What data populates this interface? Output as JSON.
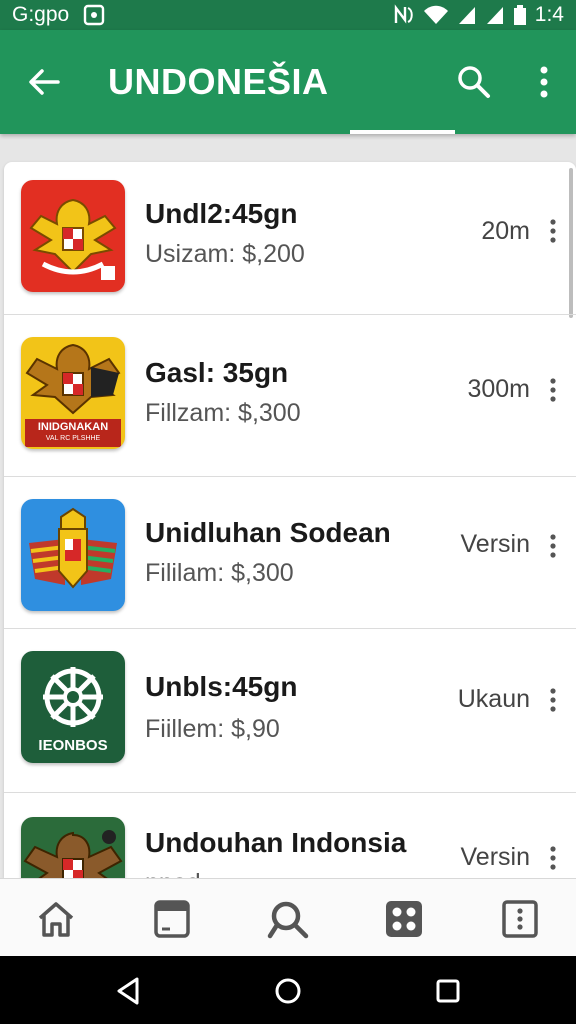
{
  "status_bar": {
    "carrier": "G:gpo",
    "time": "1:4",
    "icons": [
      "notification-icon",
      "nfc-icon",
      "wifi-icon",
      "signal-icon",
      "signal-icon",
      "battery-icon"
    ]
  },
  "app_bar": {
    "title": "UNDONEŠIA",
    "back_icon": "arrow-back-icon",
    "search_icon": "search-icon",
    "more_icon": "more-vert-icon"
  },
  "list": {
    "items": [
      {
        "title": "Undl2:45gn",
        "subtitle": "Usizam: $,200",
        "meta": "20m",
        "icon": "garuda-emblem-red",
        "icon_bg": "#e22f22"
      },
      {
        "title": "Gasl: 35gn",
        "subtitle": "Fillzam: $,300",
        "meta": "300m",
        "icon": "garuda-emblem-yellow",
        "icon_bg": "#f2c418",
        "icon_text": "INIDGNAKAN",
        "icon_subtext": "VAL RC PLSHHE"
      },
      {
        "title": "Unidluhan Sodean",
        "subtitle": "Fililam: $,300",
        "meta": "Versin",
        "icon": "crest-emblem-blue",
        "icon_bg": "#2f8fe0"
      },
      {
        "title": "Unbls:45gn",
        "subtitle": "Fiillem: $,90",
        "meta": "Ukaun",
        "icon": "wheel-emblem-green",
        "icon_bg": "#1e5e3a",
        "icon_text": "IEONBOS"
      },
      {
        "title": "Undouhan Indonsia",
        "subtitle": "nnad",
        "meta": "Versin",
        "icon": "garuda-emblem-green",
        "icon_bg": "#2b6b3a"
      }
    ]
  },
  "bottom_nav": {
    "items": [
      "home-icon",
      "tablet-icon",
      "search-icon",
      "apps-grid-icon",
      "more-box-icon"
    ]
  },
  "system_nav": {
    "items": [
      "back-triangle-icon",
      "home-circle-icon",
      "recents-square-icon"
    ]
  },
  "colors": {
    "status_bar": "#1e7a4b",
    "app_bar": "#21955b",
    "accent": "#ffffff"
  }
}
